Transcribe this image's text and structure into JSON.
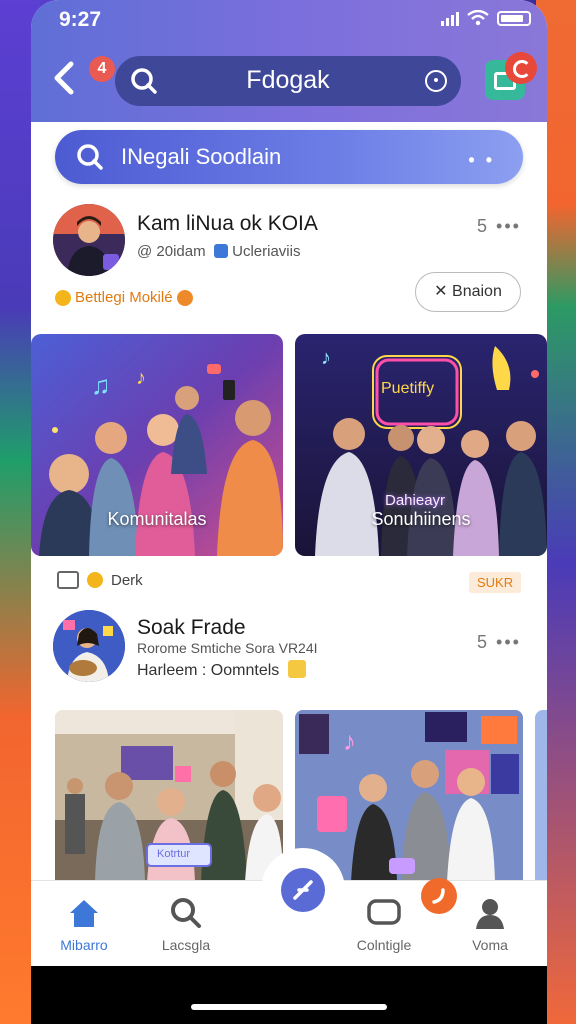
{
  "status_bar": {
    "time": "9:27"
  },
  "header": {
    "notification_count": "4",
    "title": "Fdogak"
  },
  "search": {
    "placeholder": "INegali Soodlain"
  },
  "post1": {
    "title": "Kam liNua ok KOIA",
    "subtitle_left": "@ 20idam",
    "subtitle_right": "Ucleriaviis",
    "count": "5",
    "tag": "Bettlegi Mokilé",
    "follow_label": "Bnaion",
    "cards": [
      {
        "label": "Komunitalas"
      },
      {
        "label": "Sonuhiinens",
        "neon_top": "Puetiffy",
        "neon_mid": "Dahieayr"
      }
    ],
    "meta_label": "Derk",
    "meta_tag": "SUKR"
  },
  "post2": {
    "title": "Soak Frade",
    "line1": "Rorome Smtiche Sora VR24I",
    "line2": "Harleem : Oomntels",
    "count": "5",
    "card_sign": "Kotrtur"
  },
  "bottom_nav": {
    "items": [
      {
        "label": "Mibarro",
        "icon": "home-icon",
        "active": true
      },
      {
        "label": "Lacsgla",
        "icon": "search-icon",
        "active": false
      },
      {
        "label": "Colntigle",
        "icon": "chat-icon",
        "active": false
      },
      {
        "label": "Voma",
        "icon": "profile-icon",
        "active": false
      }
    ]
  },
  "colors": {
    "header_start": "#5f6fd6",
    "header_end": "#8a78d8",
    "accent_blue": "#3d78d8",
    "badge_red": "#e85a52",
    "badge_orange": "#ef6a2b",
    "tag_orange": "#e07b12"
  }
}
